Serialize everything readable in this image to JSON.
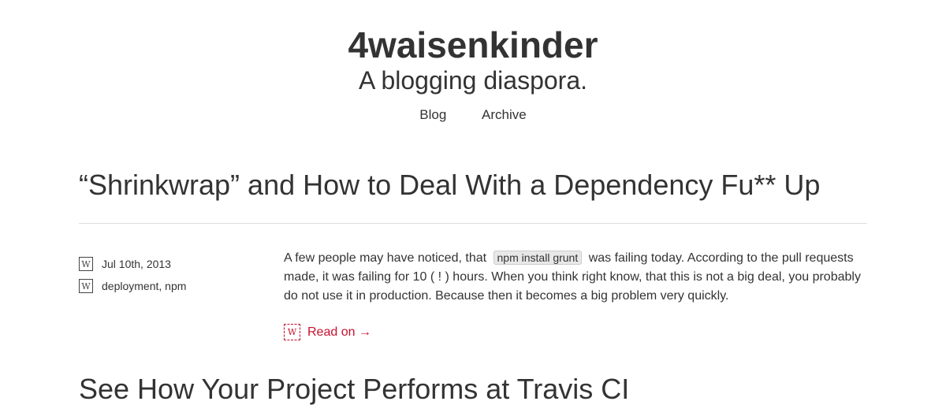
{
  "site": {
    "title": "4waisenkinder",
    "tagline": "A blogging diaspora."
  },
  "nav": {
    "items": [
      {
        "label": "Blog"
      },
      {
        "label": "Archive"
      }
    ]
  },
  "post": {
    "title": "“Shrinkwrap” and How to Deal With a Dependency Fu** Up",
    "date": "Jul 10th, 2013",
    "tags": "deployment, npm",
    "excerpt_before": "A few people may have noticed, that",
    "code": "npm install grunt",
    "excerpt_after": "was failing today. According to the pull requests made, it was failing for 10 ( ! ) hours. When you think right know, that this is not a big deal, you probably do not use it in production. Because then it becomes a big problem very quickly.",
    "read_on": "Read on →",
    "stamp_glyph": "W"
  },
  "next_post": {
    "title": "See How Your Project Performs at Travis CI"
  },
  "colors": {
    "text": "#333333",
    "accent": "#c8102e",
    "rule": "#dddddd"
  }
}
